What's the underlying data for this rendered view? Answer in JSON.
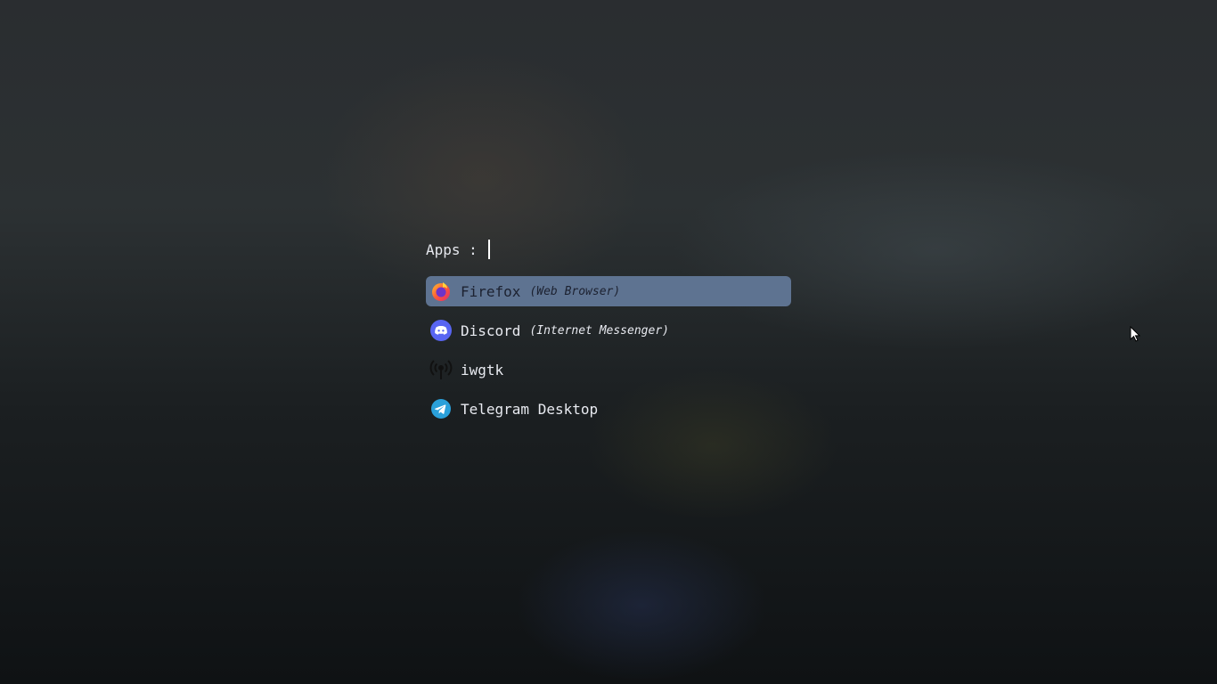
{
  "prompt": {
    "label": "Apps :",
    "query": ""
  },
  "apps": [
    {
      "name": "Firefox",
      "description": "(Web Browser)",
      "icon": "firefox-icon",
      "selected": true
    },
    {
      "name": "Discord",
      "description": "(Internet Messenger)",
      "icon": "discord-icon",
      "selected": false
    },
    {
      "name": "iwgtk",
      "description": "",
      "icon": "wireless-antenna-icon",
      "selected": false
    },
    {
      "name": "Telegram Desktop",
      "description": "",
      "icon": "telegram-icon",
      "selected": false
    }
  ],
  "colors": {
    "selection": "#5e7391",
    "text": "#e8eaf0"
  }
}
